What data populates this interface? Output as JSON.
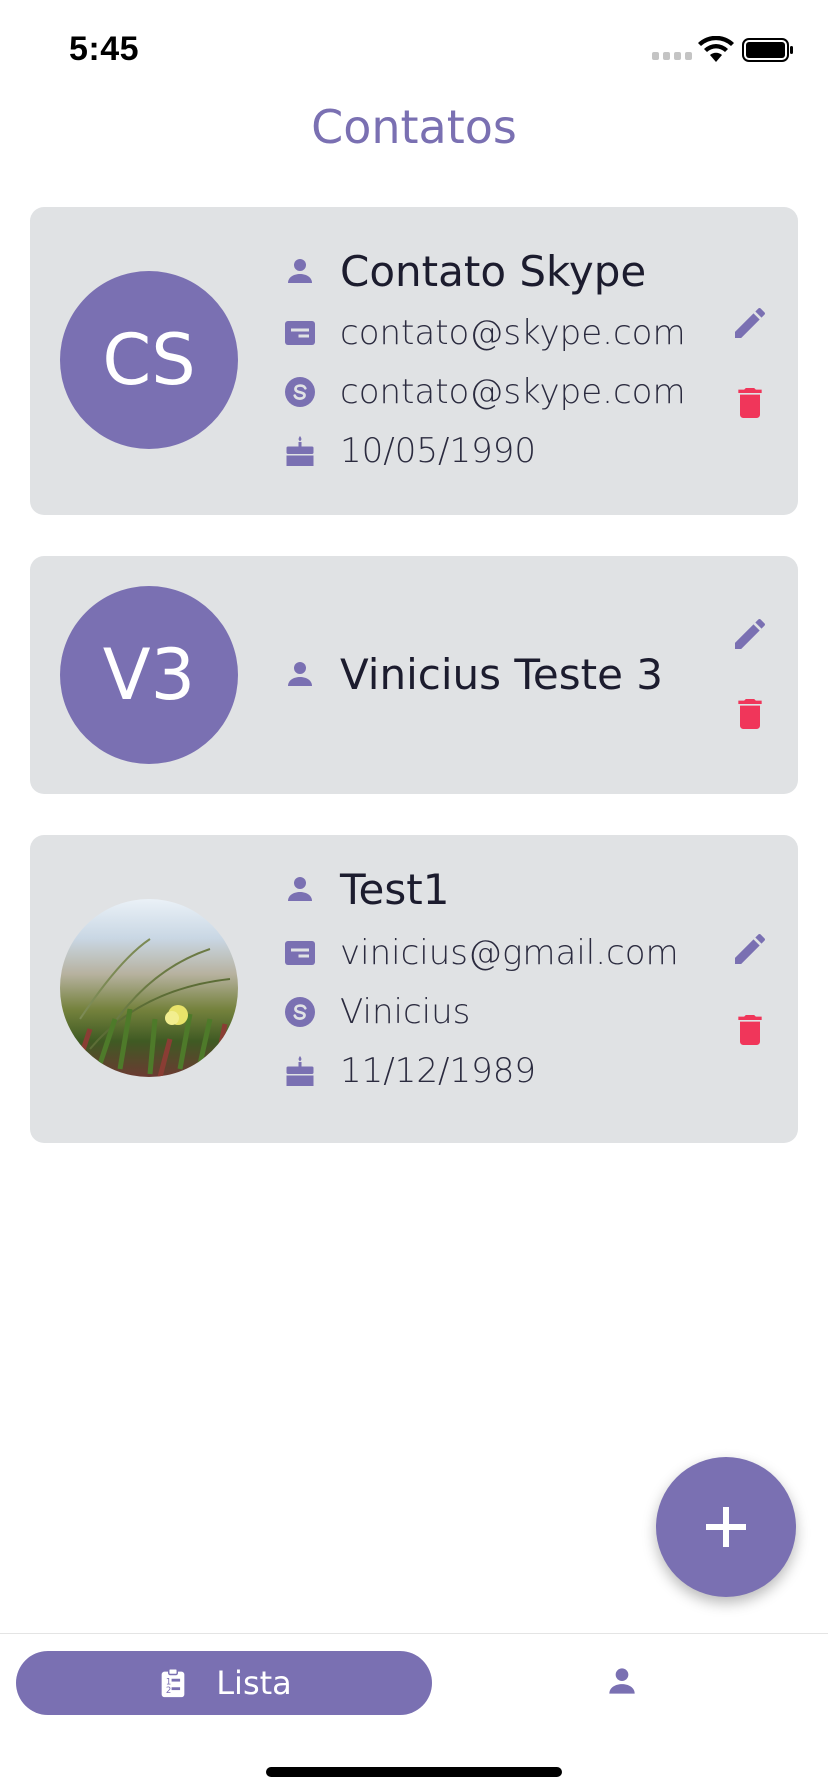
{
  "status": {
    "time": "5:45"
  },
  "header": {
    "title": "Contatos"
  },
  "contacts": [
    {
      "initials": "CS",
      "name": "Contato Skype",
      "email": "contato@skype.com",
      "skype": "contato@skype.com",
      "birthday": "10/05/1990",
      "has_photo": false
    },
    {
      "initials": "V3",
      "name": "Vinicius Teste 3",
      "email": "",
      "skype": "",
      "birthday": "",
      "has_photo": false
    },
    {
      "initials": "",
      "name": "Test1",
      "email": "vinicius@gmail.com",
      "skype": "Vinicius",
      "birthday": "11/12/1989",
      "has_photo": true
    }
  ],
  "icons": {
    "name": "person-icon",
    "email": "email-card-icon",
    "skype": "skype-icon",
    "birthday": "cake-icon",
    "edit": "pencil-icon",
    "delete": "trash-icon",
    "add": "plus-icon",
    "list_tab": "clipboard-list-icon",
    "profile_tab": "person-icon"
  },
  "tabs": {
    "list_label": "Lista"
  },
  "colors": {
    "accent": "#7a70b2",
    "delete": "#f0365a",
    "card": "#e0e2e4"
  }
}
